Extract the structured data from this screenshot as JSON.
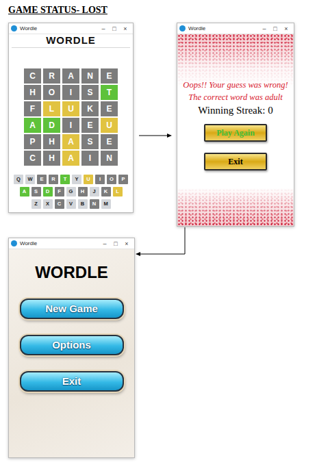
{
  "heading": "GAME STATUS- LOST",
  "windows": [
    {
      "kind": "game",
      "title": "Wordle",
      "controls": [
        "–",
        "□",
        "×"
      ],
      "logo": "WORDLE",
      "rows": [
        [
          {
            "letter": "C",
            "state": "absent"
          },
          {
            "letter": "R",
            "state": "absent"
          },
          {
            "letter": "A",
            "state": "absent"
          },
          {
            "letter": "N",
            "state": "absent"
          },
          {
            "letter": "E",
            "state": "absent"
          }
        ],
        [
          {
            "letter": "H",
            "state": "absent"
          },
          {
            "letter": "O",
            "state": "absent"
          },
          {
            "letter": "I",
            "state": "absent"
          },
          {
            "letter": "S",
            "state": "absent"
          },
          {
            "letter": "T",
            "state": "correct"
          }
        ],
        [
          {
            "letter": "F",
            "state": "absent"
          },
          {
            "letter": "L",
            "state": "present"
          },
          {
            "letter": "U",
            "state": "present"
          },
          {
            "letter": "K",
            "state": "absent"
          },
          {
            "letter": "E",
            "state": "absent"
          }
        ],
        [
          {
            "letter": "A",
            "state": "correct"
          },
          {
            "letter": "D",
            "state": "correct"
          },
          {
            "letter": "I",
            "state": "absent"
          },
          {
            "letter": "E",
            "state": "absent"
          },
          {
            "letter": "U",
            "state": "present"
          }
        ],
        [
          {
            "letter": "P",
            "state": "absent"
          },
          {
            "letter": "H",
            "state": "absent"
          },
          {
            "letter": "A",
            "state": "present"
          },
          {
            "letter": "S",
            "state": "absent"
          },
          {
            "letter": "E",
            "state": "absent"
          }
        ],
        [
          {
            "letter": "C",
            "state": "absent"
          },
          {
            "letter": "H",
            "state": "absent"
          },
          {
            "letter": "A",
            "state": "present"
          },
          {
            "letter": "I",
            "state": "absent"
          },
          {
            "letter": "N",
            "state": "absent"
          }
        ]
      ],
      "keyboard": [
        [
          {
            "letter": "Q",
            "state": "unused"
          },
          {
            "letter": "W",
            "state": "unused"
          },
          {
            "letter": "E",
            "state": "absent"
          },
          {
            "letter": "R",
            "state": "absent"
          },
          {
            "letter": "T",
            "state": "correct"
          },
          {
            "letter": "Y",
            "state": "unused"
          },
          {
            "letter": "U",
            "state": "present"
          },
          {
            "letter": "I",
            "state": "absent"
          },
          {
            "letter": "O",
            "state": "absent"
          },
          {
            "letter": "P",
            "state": "absent"
          }
        ],
        [
          {
            "letter": "A",
            "state": "correct"
          },
          {
            "letter": "S",
            "state": "absent"
          },
          {
            "letter": "D",
            "state": "correct"
          },
          {
            "letter": "F",
            "state": "absent"
          },
          {
            "letter": "G",
            "state": "unused"
          },
          {
            "letter": "H",
            "state": "absent"
          },
          {
            "letter": "J",
            "state": "unused"
          },
          {
            "letter": "K",
            "state": "absent"
          },
          {
            "letter": "L",
            "state": "present"
          }
        ],
        [
          {
            "letter": "Z",
            "state": "unused"
          },
          {
            "letter": "X",
            "state": "unused"
          },
          {
            "letter": "C",
            "state": "absent"
          },
          {
            "letter": "V",
            "state": "unused"
          },
          {
            "letter": "B",
            "state": "unused"
          },
          {
            "letter": "N",
            "state": "absent"
          },
          {
            "letter": "M",
            "state": "unused"
          }
        ]
      ]
    },
    {
      "kind": "result",
      "title": "Wordle",
      "controls": [
        "–",
        "□",
        "×"
      ],
      "message": "Oops!! Your guess was wrong!",
      "answer": "The correct word was adult",
      "streak": "Winning Streak: 0",
      "buttons": [
        "Play Again",
        "Exit"
      ]
    },
    {
      "kind": "menu",
      "title": "Wordle",
      "controls": [
        "–",
        "□",
        "×"
      ],
      "logo": "WORDLE",
      "buttons": [
        "New Game",
        "Options",
        "Exit"
      ]
    }
  ]
}
